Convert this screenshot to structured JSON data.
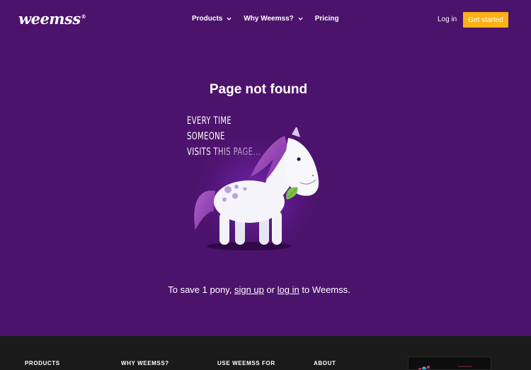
{
  "header": {
    "logo": "weemss",
    "logo_mark": "®",
    "nav": [
      {
        "label": "Products",
        "has_dropdown": true
      },
      {
        "label": "Why Weemss?",
        "has_dropdown": true
      },
      {
        "label": "Pricing",
        "has_dropdown": false
      }
    ],
    "login_label": "Log in",
    "cta_label": "Get started"
  },
  "main": {
    "title": "Page not found",
    "caption_line1": "Every time someone",
    "caption_line2": "visits this page...",
    "illustration": "sad-pony",
    "message": {
      "before": "To save 1 pony, ",
      "signup": "sign up",
      "middle": " or ",
      "login": "log in",
      "after": " to Weemss."
    }
  },
  "footer": {
    "columns": [
      "PRODUCTS",
      "WHY WEEMSS?",
      "USE WEEMSS FOR",
      "ABOUT"
    ]
  },
  "colors": {
    "background": "#4c136c",
    "accent": "#fcb117",
    "footer": "#1a1a1a"
  }
}
